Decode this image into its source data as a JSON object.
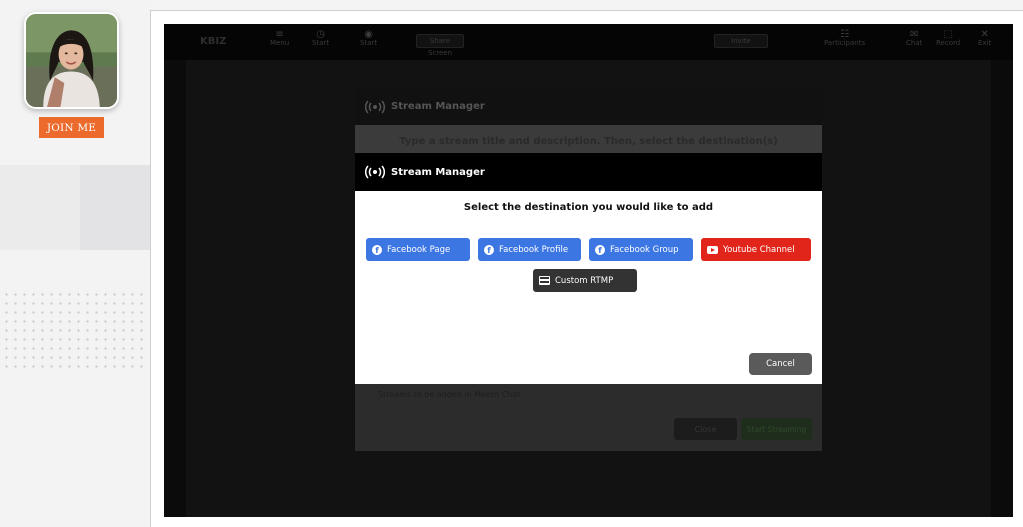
{
  "sidebar": {
    "join_label": "JOIN ME"
  },
  "toolbar": {
    "logo": "KBIZ",
    "items": [
      "Menu",
      "Start",
      "Start",
      "Share Screen",
      "Invite",
      "Participants",
      "Chat",
      "Record",
      "Exit"
    ]
  },
  "background_dialog": {
    "title": "Stream Manager",
    "instruction": "Type a stream title and description. Then, select the destination(s)",
    "note": "Streams to be added in Meetn Chat",
    "close_label": "Close",
    "start_label": "Start Streaming"
  },
  "modal": {
    "title": "Stream Manager",
    "subtitle": "Select the destination you would like to add",
    "destinations": [
      {
        "label": "Facebook Page",
        "icon": "facebook-icon",
        "color": "#3c76e3"
      },
      {
        "label": "Facebook Profile",
        "icon": "facebook-icon",
        "color": "#3c76e3"
      },
      {
        "label": "Facebook Group",
        "icon": "facebook-icon",
        "color": "#3c76e3"
      },
      {
        "label": "Youtube Channel",
        "icon": "youtube-icon",
        "color": "#e1251b"
      },
      {
        "label": "Custom RTMP",
        "icon": "rtmp-server-icon",
        "color": "#333334"
      }
    ],
    "cancel_label": "Cancel"
  },
  "colors": {
    "accent_orange": "#ec6a2c",
    "facebook_blue": "#3c76e3",
    "youtube_red": "#e1251b",
    "overlay_dark": "#0b0b0c"
  }
}
